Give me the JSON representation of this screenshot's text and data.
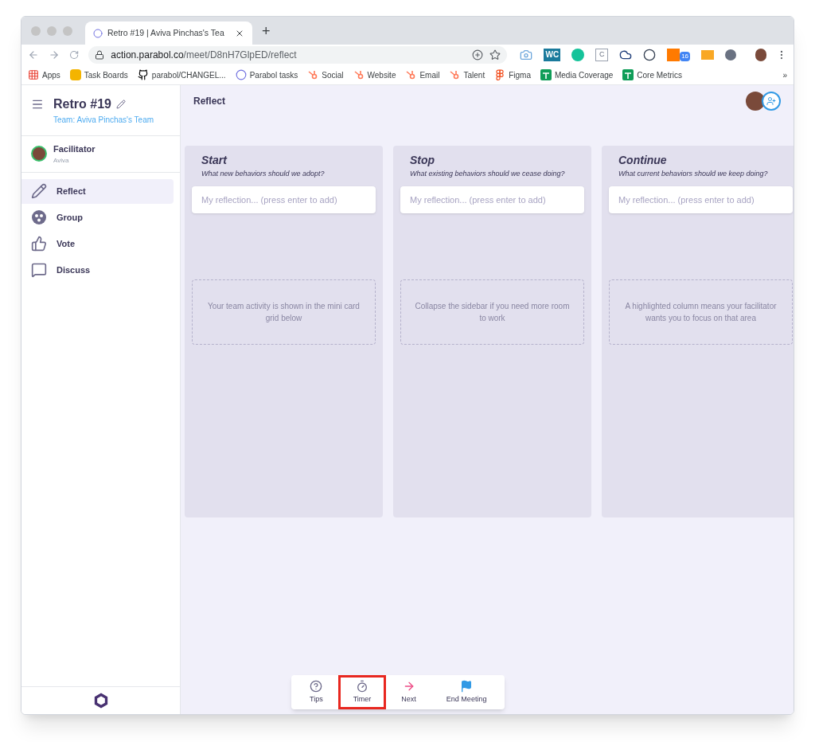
{
  "browser": {
    "tabs": [
      {
        "title": "Retro #19 | Aviva Pinchas's Tea",
        "selected": true
      }
    ],
    "new_tab": "+",
    "url": {
      "domain": "action.parabol.co",
      "path": "/meet/D8nH7GlpED/reflect"
    },
    "extensions": [
      {
        "kind": "camera"
      },
      {
        "kind": "tile",
        "label": "WC"
      },
      {
        "kind": "grammar"
      },
      {
        "kind": "calendar",
        "label": "C"
      },
      {
        "kind": "cloud"
      },
      {
        "kind": "ring"
      },
      {
        "kind": "hub",
        "badge": "16"
      },
      {
        "kind": "chart"
      },
      {
        "kind": "sphere"
      }
    ],
    "bookmarks": [
      {
        "kind": "apps",
        "label": "Apps"
      },
      {
        "kind": "hands",
        "label": "Task Boards"
      },
      {
        "kind": "github",
        "label": "parabol/CHANGEL..."
      },
      {
        "kind": "parabol",
        "label": "Parabol tasks"
      },
      {
        "kind": "hub",
        "label": "Social"
      },
      {
        "kind": "hub",
        "label": "Website"
      },
      {
        "kind": "hub",
        "label": "Email"
      },
      {
        "kind": "hub",
        "label": "Talent"
      },
      {
        "kind": "figma",
        "label": "Figma"
      },
      {
        "kind": "sheet",
        "label": "Media Coverage"
      },
      {
        "kind": "sheet",
        "label": "Core Metrics"
      }
    ],
    "more": "»"
  },
  "sidebar": {
    "title": "Retro #19",
    "team": "Team: Aviva Pinchas's Team",
    "facilitator": {
      "label": "Facilitator",
      "name": "Aviva"
    },
    "items": [
      {
        "kind": "reflect",
        "label": "Reflect",
        "selected": true
      },
      {
        "kind": "group",
        "label": "Group",
        "selected": false
      },
      {
        "kind": "vote",
        "label": "Vote",
        "selected": false
      },
      {
        "kind": "discuss",
        "label": "Discuss",
        "selected": false
      }
    ]
  },
  "header": {
    "title": "Reflect"
  },
  "columns": [
    {
      "title": "Start",
      "prompt": "What new behaviors should we adopt?",
      "placeholder": "My reflection... (press enter to add)",
      "tip": "Your team activity is shown in the mini card grid below"
    },
    {
      "title": "Stop",
      "prompt": "What existing behaviors should we cease doing?",
      "placeholder": "My reflection... (press enter to add)",
      "tip": "Collapse the sidebar if you need more room to work"
    },
    {
      "title": "Continue",
      "prompt": "What current behaviors should we keep doing?",
      "placeholder": "My reflection... (press enter to add)",
      "tip": "A highlighted column means your facilitator wants you to focus on that area"
    }
  ],
  "controls": [
    {
      "kind": "tips",
      "label": "Tips",
      "highlighted": false
    },
    {
      "kind": "timer",
      "label": "Timer",
      "highlighted": true
    },
    {
      "kind": "next",
      "label": "Next",
      "highlighted": false
    },
    {
      "kind": "end",
      "label": "End Meeting",
      "highlighted": false
    }
  ]
}
